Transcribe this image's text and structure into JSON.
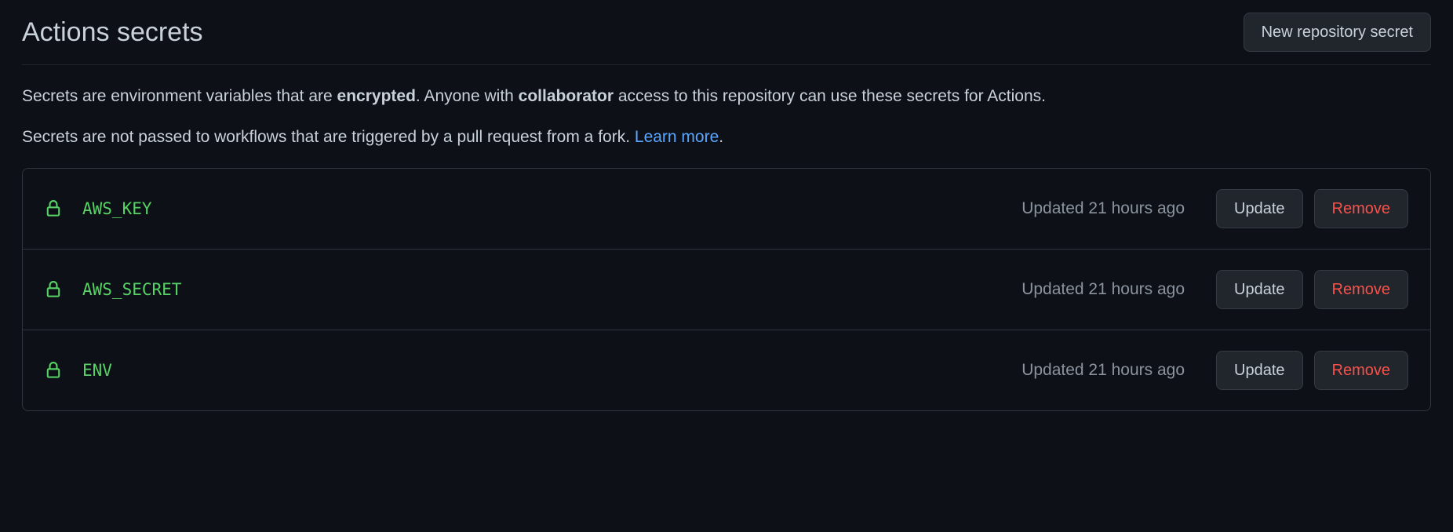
{
  "header": {
    "title": "Actions secrets",
    "new_button": "New repository secret"
  },
  "description": {
    "p1_part1": "Secrets are environment variables that are ",
    "p1_strong1": "encrypted",
    "p1_part2": ". Anyone with ",
    "p1_strong2": "collaborator",
    "p1_part3": " access to this repository can use these secrets for Actions.",
    "p2_text": "Secrets are not passed to workflows that are triggered by a pull request from a fork. ",
    "p2_link": "Learn more",
    "p2_after": "."
  },
  "buttons": {
    "update": "Update",
    "remove": "Remove"
  },
  "secrets": [
    {
      "name": "AWS_KEY",
      "updated": "Updated 21 hours ago"
    },
    {
      "name": "AWS_SECRET",
      "updated": "Updated 21 hours ago"
    },
    {
      "name": "ENV",
      "updated": "Updated 21 hours ago"
    }
  ]
}
